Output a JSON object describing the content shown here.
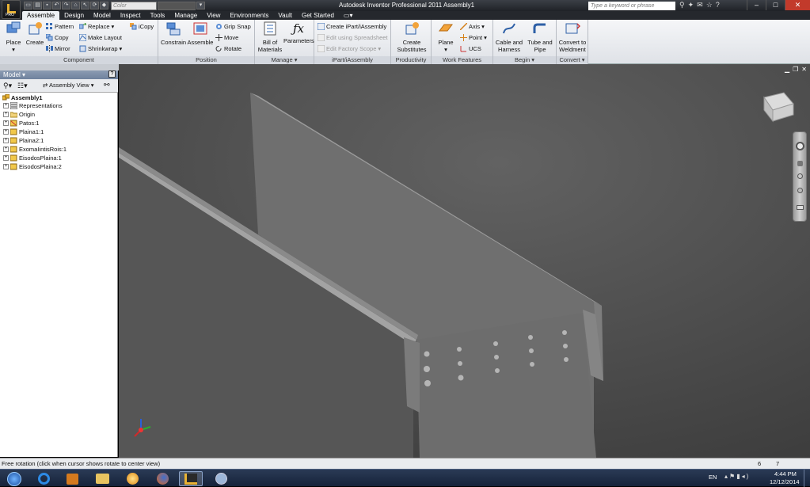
{
  "app": {
    "window_title": "Autodesk Inventor Professional 2011   Assembly1",
    "pro_badge": "PRO",
    "color_combo": "Color",
    "search_placeholder": "Type a keyword or phrase"
  },
  "tabs": [
    "Assemble",
    "Design",
    "Model",
    "Inspect",
    "Tools",
    "Manage",
    "View",
    "Environments",
    "Vault",
    "Get Started"
  ],
  "ribbon": {
    "component": {
      "title": "Component",
      "place": "Place",
      "create": "Create",
      "pattern": "Pattern",
      "copy": "Copy",
      "mirror": "Mirror",
      "replace": "Replace",
      "make_layout": "Make Layout",
      "shrinkwrap": "Shrinkwrap",
      "icopy": "iCopy"
    },
    "position": {
      "title": "Position",
      "constrain": "Constrain",
      "assemble": "Assemble",
      "grip_snap": "Grip Snap",
      "move": "Move",
      "rotate": "Rotate"
    },
    "manage": {
      "title": "Manage ▾",
      "bom_line1": "Bill of",
      "bom_line2": "Materials",
      "parameters": "Parameters"
    },
    "ipart": {
      "title": "iPart/iAssembly",
      "create": "Create iPart/iAssembly",
      "edit_spreadsheet": "Edit using Spreadsheet",
      "edit_factory": "Edit Factory Scope"
    },
    "productivity": {
      "title": "Productivity",
      "line1": "Create",
      "line2": "Substitutes"
    },
    "work_features": {
      "title": "Work Features",
      "plane": "Plane",
      "axis": "Axis",
      "point": "Point",
      "ucs": "UCS"
    },
    "begin": {
      "title": "Begin ▾",
      "cable_line1": "Cable and",
      "cable_line2": "Harness",
      "tube_line1": "Tube and",
      "tube_line2": "Pipe"
    },
    "convert": {
      "title": "Convert ▾",
      "line1": "Convert to",
      "line2": "Weldment"
    }
  },
  "browser": {
    "header": "Model ▾",
    "view_label": "Assembly View",
    "help": "?",
    "items": [
      {
        "label": "Assembly1",
        "icon": "assembly-icon"
      },
      {
        "label": "Representations",
        "icon": "representations-icon"
      },
      {
        "label": "Origin",
        "icon": "folder-icon"
      },
      {
        "label": "Patos:1",
        "icon": "part-icon"
      },
      {
        "label": "Plaina1:1",
        "icon": "part-icon"
      },
      {
        "label": "Plaina2:1",
        "icon": "part-icon"
      },
      {
        "label": "ExomaIintisRois:1",
        "icon": "part-icon"
      },
      {
        "label": "EisodosPlaina:1",
        "icon": "part-icon"
      },
      {
        "label": "EisodosPlaina:2",
        "icon": "part-icon"
      }
    ]
  },
  "status": {
    "message": "Free rotation (click when cursor shows rotate to center view)",
    "count1": "6",
    "count2": "7"
  },
  "taskbar": {
    "lang": "EN",
    "time": "4:44 PM",
    "date": "12/12/2014"
  },
  "colors": {
    "accent": "#e9b233",
    "ribbon_bg": "#e6e9ee",
    "viewport_bg": "#4d4d4d"
  }
}
